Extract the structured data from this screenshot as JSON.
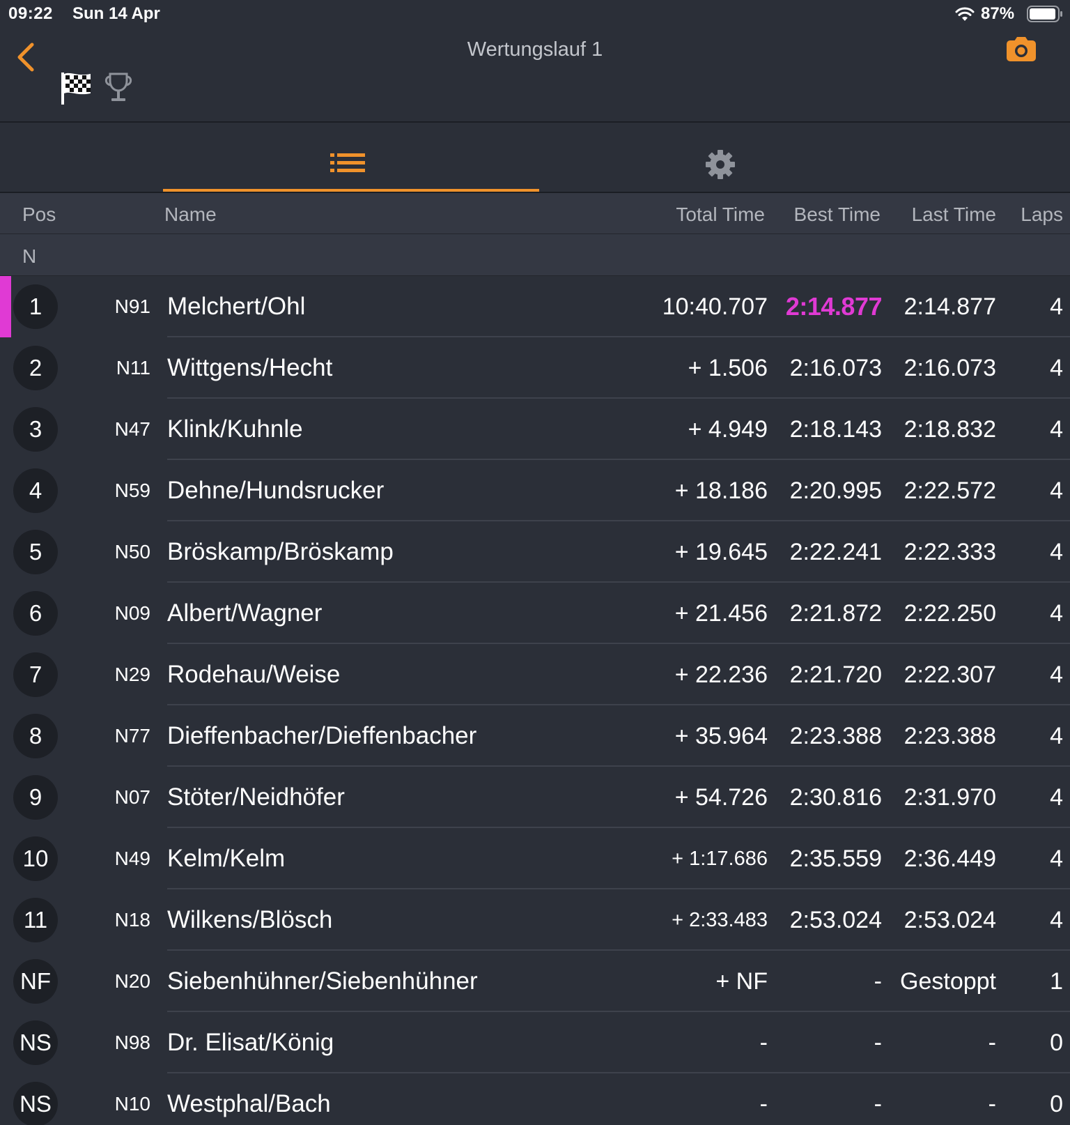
{
  "status_bar": {
    "time": "09:22",
    "date": "Sun 14 Apr",
    "battery": "87%"
  },
  "nav": {
    "title": "Wertungslauf 1",
    "back_icon": "chevron-left-icon",
    "camera_icon": "camera-icon",
    "flag_icon": "checkered-flag-icon",
    "trophy_icon": "trophy-icon"
  },
  "tabs": [
    {
      "name": "list",
      "icon": "list-icon",
      "active": true
    },
    {
      "name": "settings",
      "icon": "gear-icon",
      "active": false
    }
  ],
  "columns": {
    "pos": "Pos",
    "name": "Name",
    "total": "Total Time",
    "best": "Best Time",
    "last": "Last Time",
    "laps": "Laps"
  },
  "group": "N",
  "colors": {
    "accent": "#f0922b",
    "fastest": "#e03ad4",
    "background": "#2b2f38"
  },
  "rows": [
    {
      "pos": "1",
      "car": "N91",
      "name": "Melchert/Ohl",
      "total": "10:40.707",
      "best": "2:14.877",
      "last": "2:14.877",
      "laps": "4"
    },
    {
      "pos": "2",
      "car": "N11",
      "name": "Wittgens/Hecht",
      "total": "+ 1.506",
      "best": "2:16.073",
      "last": "2:16.073",
      "laps": "4"
    },
    {
      "pos": "3",
      "car": "N47",
      "name": "Klink/Kuhnle",
      "total": "+ 4.949",
      "best": "2:18.143",
      "last": "2:18.832",
      "laps": "4"
    },
    {
      "pos": "4",
      "car": "N59",
      "name": "Dehne/Hundsrucker",
      "total": "+ 18.186",
      "best": "2:20.995",
      "last": "2:22.572",
      "laps": "4"
    },
    {
      "pos": "5",
      "car": "N50",
      "name": "Bröskamp/Bröskamp",
      "total": "+ 19.645",
      "best": "2:22.241",
      "last": "2:22.333",
      "laps": "4"
    },
    {
      "pos": "6",
      "car": "N09",
      "name": "Albert/Wagner",
      "total": "+ 21.456",
      "best": "2:21.872",
      "last": "2:22.250",
      "laps": "4"
    },
    {
      "pos": "7",
      "car": "N29",
      "name": "Rodehau/Weise",
      "total": "+ 22.236",
      "best": "2:21.720",
      "last": "2:22.307",
      "laps": "4"
    },
    {
      "pos": "8",
      "car": "N77",
      "name": "Dieffenbacher/Dieffenbacher",
      "total": "+ 35.964",
      "best": "2:23.388",
      "last": "2:23.388",
      "laps": "4"
    },
    {
      "pos": "9",
      "car": "N07",
      "name": "Stöter/Neidhöfer",
      "total": "+ 54.726",
      "best": "2:30.816",
      "last": "2:31.970",
      "laps": "4"
    },
    {
      "pos": "10",
      "car": "N49",
      "name": "Kelm/Kelm",
      "total": "+ 1:17.686",
      "best": "2:35.559",
      "last": "2:36.449",
      "laps": "4"
    },
    {
      "pos": "11",
      "car": "N18",
      "name": "Wilkens/Blösch",
      "total": "+ 2:33.483",
      "best": "2:53.024",
      "last": "2:53.024",
      "laps": "4"
    },
    {
      "pos": "NF",
      "car": "N20",
      "name": "Siebenhühner/Siebenhühner",
      "total": "+ NF",
      "best": "-",
      "last": "Gestoppt",
      "laps": "1"
    },
    {
      "pos": "NS",
      "car": "N98",
      "name": "Dr. Elisat/König",
      "total": "-",
      "best": "-",
      "last": "-",
      "laps": "0"
    },
    {
      "pos": "NS",
      "car": "N10",
      "name": "Westphal/Bach",
      "total": "-",
      "best": "-",
      "last": "-",
      "laps": "0"
    }
  ]
}
